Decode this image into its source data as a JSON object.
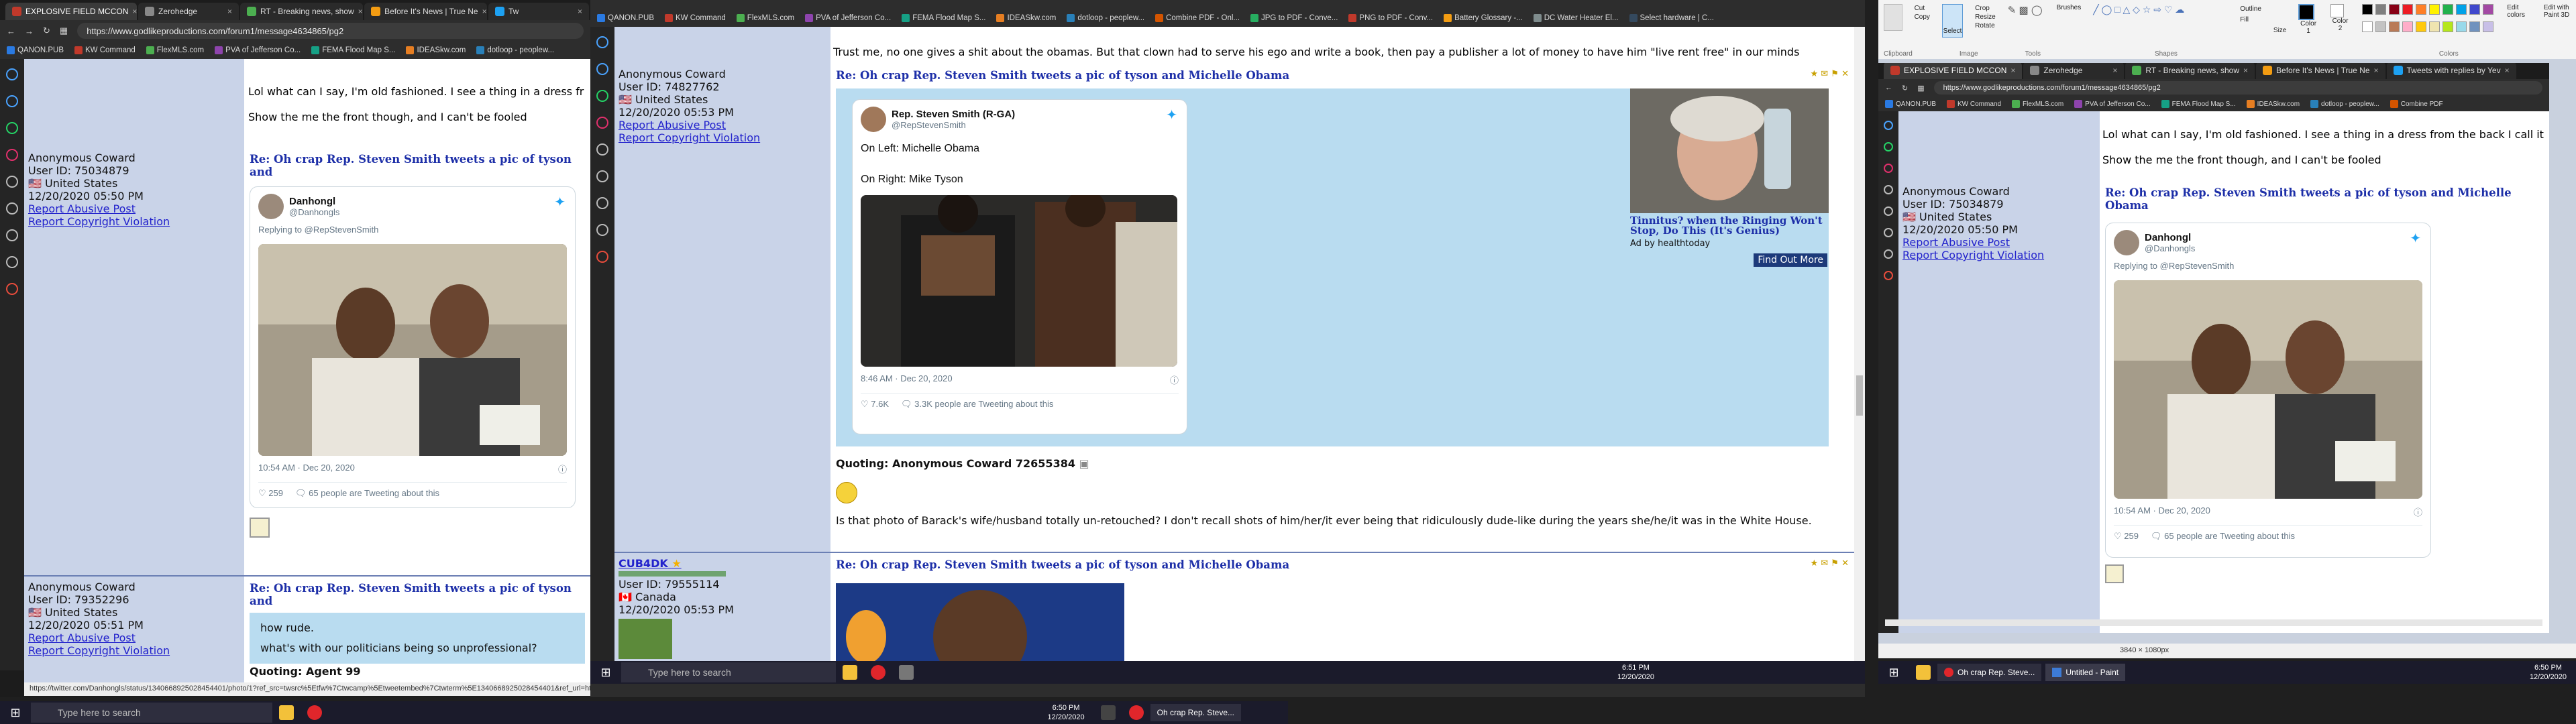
{
  "left_window": {
    "tabs": [
      {
        "label": "EXPLOSIVE FIELD MCCON",
        "color": "#c0392b"
      },
      {
        "label": "Zerohedge",
        "color": "#888888"
      },
      {
        "label": "RT - Breaking news, show",
        "color": "#4caf50"
      },
      {
        "label": "Before It's News | True Ne",
        "color": "#f39c12"
      },
      {
        "label": "Tw",
        "color": "#1da1f2"
      }
    ],
    "url": "https://www.godlikeproductions.com/forum1/message4634865/pg2",
    "bookmarks": [
      "QANON.PUB",
      "KW Command",
      "FlexMLS.com",
      "PVA of Jefferson Co...",
      "FEMA Flood Map S...",
      "IDEASkw.com",
      "dotloop - peoplew..."
    ],
    "status_url": "https://twitter.com/Danhongls/status/1340668925028454401/photo/1?ref_src=twsrc%5Etfw%7Ctwcamp%5Etweetembed%7Ctwterm%5E1340668925028454401&ref_url=http%3A%2F%2Fwww.godlikeproductions.com%2Fforum1%2Fmessage4634865%2Fpg2",
    "top_text_1": "Lol what can I say, I'm old fashioned. I see a thing in a dress fr",
    "top_text_2": "Show the me the front though, and I can't be fooled",
    "post1": {
      "author": "Anonymous Coward",
      "user_id": "User ID: 75034879",
      "country": "United States",
      "date": "12/20/2020 05:50 PM",
      "report_abuse": "Report Abusive Post",
      "report_copyright": "Report Copyright Violation",
      "title": "Re: Oh crap Rep. Steven Smith tweets a pic of tyson and",
      "tweet_name": "Danhongl",
      "tweet_handle": "@Danhongls",
      "tweet_reply": "Replying to @RepStevenSmith",
      "tweet_time": "10:54 AM · Dec 20, 2020",
      "tweet_likes": "259",
      "tweet_retweets": "65 people are Tweeting about this"
    },
    "post2": {
      "author": "Anonymous Coward",
      "user_id": "User ID: 79352296",
      "country": "United States",
      "date": "12/20/2020 05:51 PM",
      "report_abuse": "Report Abusive Post",
      "report_copyright": "Report Copyright Violation",
      "title": "Re: Oh crap Rep. Steven Smith tweets a pic of tyson and",
      "line1": "how rude.",
      "line2": "what's with our politicians being so unprofessional?",
      "quoting": "Quoting:",
      "quoted": "Agent 99"
    }
  },
  "middle_window": {
    "bookmarks": [
      "QANON.PUB",
      "KW Command",
      "FlexMLS.com",
      "PVA of Jefferson Co...",
      "FEMA Flood Map S...",
      "IDEASkw.com",
      "dotloop - peoplew...",
      "Combine PDF - Onl...",
      "JPG to PDF - Conve...",
      "PNG to PDF - Conv...",
      "Battery Glossary -...",
      "DC Water Heater El...",
      "Select hardware | C..."
    ],
    "top_text": "Trust me, no one gives a shit about the obamas. But that clown had to serve his ego and write a book, then pay a publisher a lot of money to have him \"live rent free\" in our minds",
    "post1": {
      "author": "Anonymous Coward",
      "user_id": "User ID: 74827762",
      "country": "United States",
      "date": "12/20/2020 05:53 PM",
      "report_abuse": "Report Abusive Post",
      "report_copyright": "Report Copyright Violation",
      "title": "Re: Oh crap Rep. Steven Smith tweets a pic of tyson and Michelle Obama",
      "tweet_name": "Rep. Steven Smith (R-GA)",
      "tweet_handle": "@RepStevenSmith",
      "tweet_line1": "On Left: Michelle Obama",
      "tweet_line2": "On Right: Mike Tyson",
      "tweet_time": "8:46 AM · Dec 20, 2020",
      "tweet_likes": "7.6K",
      "tweet_retweets": "3.3K people are Tweeting about this",
      "ad_title": "Tinnitus? when the Ringing Won't Stop, Do This (It's Genius)",
      "ad_by": "Ad by healthtoday",
      "ad_button": "Find Out More",
      "quoting": "Quoting:",
      "quoted": "Anonymous Coward 72655384",
      "reply": "Is that photo of Barack's wife/husband totally un-retouched? I don't recall shots of him/her/it ever being that ridiculously dude-like during the years she/he/it was in the White House."
    },
    "post2": {
      "author": "CUB4DK",
      "user_id": "User ID: 79555114",
      "country": "Canada",
      "date": "12/20/2020 05:53 PM",
      "title": "Re: Oh crap Rep. Steven Smith tweets a pic of tyson and Michelle Obama"
    }
  },
  "right_window": {
    "paint_groups": [
      "Clipboard",
      "Image",
      "Tools",
      "Shapes",
      "Colors"
    ],
    "paint_labels": [
      "Paste",
      "Cut",
      "Copy",
      "Select",
      "Crop",
      "Resize",
      "Rotate",
      "Brushes",
      "Outline",
      "Fill",
      "Size",
      "Color 1",
      "Color 2",
      "Edit colors",
      "Edit with Paint 3D"
    ],
    "colors": [
      "#000000",
      "#7f7f7f",
      "#880015",
      "#ed1c24",
      "#ff7f27",
      "#fff200",
      "#22b14c",
      "#00a2e8",
      "#3f48cc",
      "#a349a4",
      "#ffffff",
      "#c3c3c3",
      "#b97a57",
      "#ffaec9",
      "#ffc90e",
      "#efe4b0",
      "#b5e61d",
      "#99d9ea",
      "#7092be",
      "#c8bfe7"
    ],
    "tabs": [
      {
        "label": "EXPLOSIVE FIELD MCCON",
        "color": "#c0392b"
      },
      {
        "label": "Zerohedge",
        "color": "#888888"
      },
      {
        "label": "RT - Breaking news, show",
        "color": "#4caf50"
      },
      {
        "label": "Before It's News | True Ne",
        "color": "#f39c12"
      },
      {
        "label": "Tweets with replies by Yev",
        "color": "#1da1f2"
      }
    ],
    "url": "https://www.godlikeproductions.com/forum1/message4634865/pg2",
    "bookmarks": [
      "QANON.PUB",
      "KW Command",
      "FlexMLS.com",
      "PVA of Jefferson Co...",
      "FEMA Flood Map S...",
      "IDEASkw.com",
      "dotloop - peoplew...",
      "Combine PDF"
    ],
    "top_text_1": "Lol what can I say, I'm old fashioned. I see a thing in a dress from the back I call it",
    "top_text_2": "Show the me the front though, and I can't be fooled",
    "post1": {
      "author": "Anonymous Coward",
      "user_id": "User ID: 75034879",
      "country": "United States",
      "date": "12/20/2020 05:50 PM",
      "report_abuse": "Report Abusive Post",
      "report_copyright": "Report Copyright Violation",
      "title": "Re: Oh crap Rep. Steven Smith tweets a pic of tyson and Michelle Obama",
      "tweet_name": "Danhongl",
      "tweet_handle": "@Danhongls",
      "tweet_reply": "Replying to @RepStevenSmith",
      "tweet_time": "10:54 AM · Dec 20, 2020",
      "tweet_likes": "259",
      "tweet_retweets": "65 people are Tweeting about this"
    },
    "paint_status": "3840 × 1080px"
  },
  "taskbars": {
    "search_placeholder": "Type here to search",
    "left_time": "6:50 PM",
    "left_date": "12/20/2020",
    "left_app": "Oh crap Rep. Steve...",
    "mid_time": "6:51 PM",
    "mid_date": "12/20/2020",
    "right_time": "6:50 PM",
    "right_date": "12/20/2020",
    "right_app1": "Oh crap Rep. Steve...",
    "right_app2": "Untitled - Paint"
  }
}
